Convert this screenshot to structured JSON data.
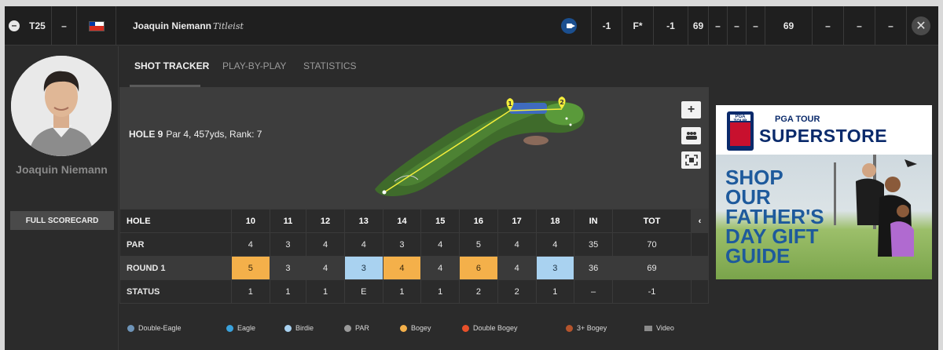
{
  "header": {
    "position": "T25",
    "today": "–",
    "player_name": "Joaquin Niemann",
    "sponsor": "Titleist",
    "score_to_par": "-1",
    "thru": "F*",
    "round_score": "-1",
    "r1": "69",
    "r2": "–",
    "r3": "–",
    "r4": "–",
    "total": "69",
    "c1": "–",
    "c2": "–",
    "c3": "–"
  },
  "sidebar": {
    "name": "Joaquin Niemann",
    "full_scorecard": "FULL SCORECARD"
  },
  "tabs": [
    "SHOT TRACKER",
    "PLAY-BY-PLAY",
    "STATISTICS"
  ],
  "hole": {
    "label": "HOLE 9",
    "details": "Par 4, 457yds, Rank: 7"
  },
  "map_controls": {
    "zoom": "+"
  },
  "scorecard": {
    "columns": [
      "HOLE",
      "10",
      "11",
      "12",
      "13",
      "14",
      "15",
      "16",
      "17",
      "18",
      "IN",
      "TOT"
    ],
    "rows": [
      {
        "label": "PAR",
        "values": [
          "4",
          "3",
          "4",
          "4",
          "3",
          "4",
          "5",
          "4",
          "4",
          "35",
          "70"
        ]
      },
      {
        "label": "ROUND 1",
        "values": [
          "5",
          "3",
          "4",
          "3",
          "4",
          "4",
          "6",
          "4",
          "3",
          "36",
          "69"
        ]
      },
      {
        "label": "STATUS",
        "values": [
          "1",
          "1",
          "1",
          "E",
          "1",
          "1",
          "2",
          "2",
          "1",
          "–",
          "-1"
        ]
      }
    ],
    "round_marks": [
      "bogey",
      "",
      "",
      "birdie",
      "bogey",
      "",
      "bogey",
      "",
      "birdie",
      "",
      ""
    ]
  },
  "legend": [
    {
      "label": "Double-Eagle",
      "color": "#6e94b8"
    },
    {
      "label": "Eagle",
      "color": "#3aa2dc"
    },
    {
      "label": "Birdie",
      "color": "#a9d2f0"
    },
    {
      "label": "PAR",
      "color": "#9a9a9a"
    },
    {
      "label": "Bogey",
      "color": "#f4b04a"
    },
    {
      "label": "Double Bogey",
      "color": "#e8502a"
    },
    {
      "label": "3+ Bogey",
      "color": "#b5542c"
    },
    {
      "label": "Video",
      "color": "#8a8a8a"
    }
  ],
  "ad": {
    "brand_top": "PGA TOUR",
    "brand_main": "SUPERSTORE",
    "shield_text": "PGA TOUR",
    "headline": [
      "SHOP",
      "OUR",
      "FATHER'S",
      "DAY GIFT",
      "GUIDE"
    ]
  }
}
